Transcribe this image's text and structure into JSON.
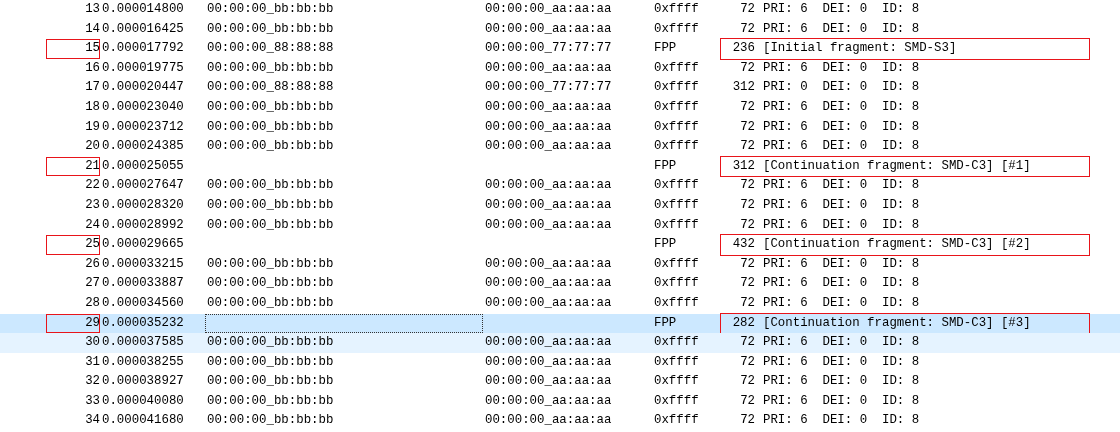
{
  "packet_list": {
    "rows": [
      {
        "no": "13",
        "time": "0.000014800",
        "source": "00:00:00_bb:bb:bb",
        "destination": "00:00:00_aa:aa:aa",
        "protocol": "0xffff",
        "length": "72",
        "info": "PRI: 6  DEI: 0  ID: 8",
        "selected": false,
        "hovered": false,
        "marked": false
      },
      {
        "no": "14",
        "time": "0.000016425",
        "source": "00:00:00_bb:bb:bb",
        "destination": "00:00:00_aa:aa:aa",
        "protocol": "0xffff",
        "length": "72",
        "info": "PRI: 6  DEI: 0  ID: 8",
        "selected": false,
        "hovered": false,
        "marked": false
      },
      {
        "no": "15",
        "time": "0.000017792",
        "source": "00:00:00_88:88:88",
        "destination": "00:00:00_77:77:77",
        "protocol": "FPP",
        "length": "236",
        "info": "[Initial fragment: SMD-S3]",
        "selected": false,
        "hovered": false,
        "marked": true
      },
      {
        "no": "16",
        "time": "0.000019775",
        "source": "00:00:00_bb:bb:bb",
        "destination": "00:00:00_aa:aa:aa",
        "protocol": "0xffff",
        "length": "72",
        "info": "PRI: 6  DEI: 0  ID: 8",
        "selected": false,
        "hovered": false,
        "marked": false
      },
      {
        "no": "17",
        "time": "0.000020447",
        "source": "00:00:00_88:88:88",
        "destination": "00:00:00_77:77:77",
        "protocol": "0xffff",
        "length": "312",
        "info": "PRI: 0  DEI: 0  ID: 8",
        "selected": false,
        "hovered": false,
        "marked": false
      },
      {
        "no": "18",
        "time": "0.000023040",
        "source": "00:00:00_bb:bb:bb",
        "destination": "00:00:00_aa:aa:aa",
        "protocol": "0xffff",
        "length": "72",
        "info": "PRI: 6  DEI: 0  ID: 8",
        "selected": false,
        "hovered": false,
        "marked": false
      },
      {
        "no": "19",
        "time": "0.000023712",
        "source": "00:00:00_bb:bb:bb",
        "destination": "00:00:00_aa:aa:aa",
        "protocol": "0xffff",
        "length": "72",
        "info": "PRI: 6  DEI: 0  ID: 8",
        "selected": false,
        "hovered": false,
        "marked": false
      },
      {
        "no": "20",
        "time": "0.000024385",
        "source": "00:00:00_bb:bb:bb",
        "destination": "00:00:00_aa:aa:aa",
        "protocol": "0xffff",
        "length": "72",
        "info": "PRI: 6  DEI: 0  ID: 8",
        "selected": false,
        "hovered": false,
        "marked": false
      },
      {
        "no": "21",
        "time": "0.000025055",
        "protocol": "FPP",
        "length": "312",
        "info": "[Continuation fragment: SMD-C3] [#1]",
        "selected": false,
        "hovered": false,
        "marked": true
      },
      {
        "no": "22",
        "time": "0.000027647",
        "source": "00:00:00_bb:bb:bb",
        "destination": "00:00:00_aa:aa:aa",
        "protocol": "0xffff",
        "length": "72",
        "info": "PRI: 6  DEI: 0  ID: 8",
        "selected": false,
        "hovered": false,
        "marked": false
      },
      {
        "no": "23",
        "time": "0.000028320",
        "source": "00:00:00_bb:bb:bb",
        "destination": "00:00:00_aa:aa:aa",
        "protocol": "0xffff",
        "length": "72",
        "info": "PRI: 6  DEI: 0  ID: 8",
        "selected": false,
        "hovered": false,
        "marked": false
      },
      {
        "no": "24",
        "time": "0.000028992",
        "source": "00:00:00_bb:bb:bb",
        "destination": "00:00:00_aa:aa:aa",
        "protocol": "0xffff",
        "length": "72",
        "info": "PRI: 6  DEI: 0  ID: 8",
        "selected": false,
        "hovered": false,
        "marked": false
      },
      {
        "no": "25",
        "time": "0.000029665",
        "protocol": "FPP",
        "length": "432",
        "info": "[Continuation fragment: SMD-C3] [#2]",
        "selected": false,
        "hovered": false,
        "marked": true
      },
      {
        "no": "26",
        "time": "0.000033215",
        "source": "00:00:00_bb:bb:bb",
        "destination": "00:00:00_aa:aa:aa",
        "protocol": "0xffff",
        "length": "72",
        "info": "PRI: 6  DEI: 0  ID: 8",
        "selected": false,
        "hovered": false,
        "marked": false
      },
      {
        "no": "27",
        "time": "0.000033887",
        "source": "00:00:00_bb:bb:bb",
        "destination": "00:00:00_aa:aa:aa",
        "protocol": "0xffff",
        "length": "72",
        "info": "PRI: 6  DEI: 0  ID: 8",
        "selected": false,
        "hovered": false,
        "marked": false
      },
      {
        "no": "28",
        "time": "0.000034560",
        "source": "00:00:00_bb:bb:bb",
        "destination": "00:00:00_aa:aa:aa",
        "protocol": "0xffff",
        "length": "72",
        "info": "PRI: 6  DEI: 0  ID: 8",
        "selected": false,
        "hovered": false,
        "marked": false
      },
      {
        "no": "29",
        "time": "0.000035232",
        "protocol": "FPP",
        "length": "282",
        "info": "[Continuation fragment: SMD-C3] [#3]",
        "selected": true,
        "hovered": false,
        "marked": true
      },
      {
        "no": "30",
        "time": "0.000037585",
        "source": "00:00:00_bb:bb:bb",
        "destination": "00:00:00_aa:aa:aa",
        "protocol": "0xffff",
        "length": "72",
        "info": "PRI: 6  DEI: 0  ID: 8",
        "selected": false,
        "hovered": true,
        "marked": false
      },
      {
        "no": "31",
        "time": "0.000038255",
        "source": "00:00:00_bb:bb:bb",
        "destination": "00:00:00_aa:aa:aa",
        "protocol": "0xffff",
        "length": "72",
        "info": "PRI: 6  DEI: 0  ID: 8",
        "selected": false,
        "hovered": false,
        "marked": false
      },
      {
        "no": "32",
        "time": "0.000038927",
        "source": "00:00:00_bb:bb:bb",
        "destination": "00:00:00_aa:aa:aa",
        "protocol": "0xffff",
        "length": "72",
        "info": "PRI: 6  DEI: 0  ID: 8",
        "selected": false,
        "hovered": false,
        "marked": false
      },
      {
        "no": "33",
        "time": "0.000040080",
        "source": "00:00:00_bb:bb:bb",
        "destination": "00:00:00_aa:aa:aa",
        "protocol": "0xffff",
        "length": "72",
        "info": "PRI: 6  DEI: 0  ID: 8",
        "selected": false,
        "hovered": false,
        "marked": false
      },
      {
        "no": "34",
        "time": "0.000041680",
        "source": "00:00:00_bb:bb:bb",
        "destination": "00:00:00_aa:aa:aa",
        "protocol": "0xffff",
        "length": "72",
        "info": "PRI: 6  DEI: 0  ID: 8",
        "selected": false,
        "hovered": false,
        "marked": false
      }
    ]
  }
}
